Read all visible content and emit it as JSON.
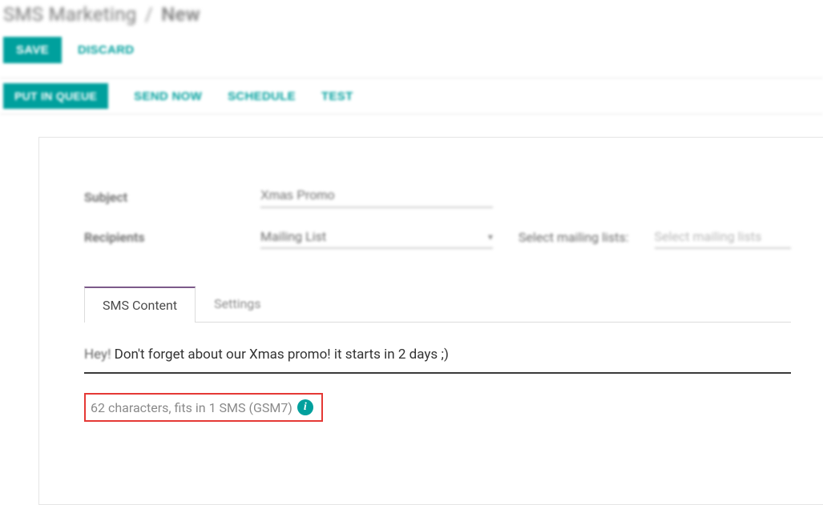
{
  "breadcrumb": {
    "module": "SMS Marketing",
    "separator": "/",
    "current": "New"
  },
  "topActions": {
    "save": "SAVE",
    "discard": "DISCARD"
  },
  "statusActions": {
    "put_in_queue": "PUT IN QUEUE",
    "send_now": "SEND NOW",
    "schedule": "SCHEDULE",
    "test": "TEST"
  },
  "form": {
    "subject_label": "Subject",
    "subject_value": "Xmas Promo",
    "recipients_label": "Recipients",
    "recipients_value": "Mailing List",
    "mailing_lists_label": "Select mailing lists:",
    "mailing_lists_placeholder": "Select mailing lists"
  },
  "tabs": {
    "sms_content": "SMS Content",
    "settings": "Settings"
  },
  "sms": {
    "prefix": "Hey!",
    "body": " Don't forget about our Xmas promo! it starts in 2 days ;)",
    "counter": "62 characters, fits in 1 SMS (GSM7)",
    "info_glyph": "i"
  }
}
